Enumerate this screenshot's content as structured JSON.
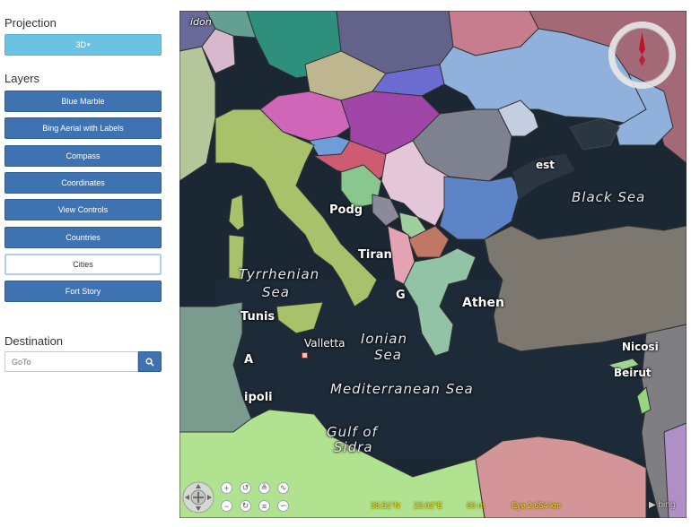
{
  "sidebar": {
    "projection_title": "Projection",
    "projection_value": "3D",
    "projection_caret": "▾",
    "layers_title": "Layers",
    "layers": [
      {
        "label": "Blue Marble",
        "active": false
      },
      {
        "label": "Bing Aerial with Labels",
        "active": false
      },
      {
        "label": "Compass",
        "active": false
      },
      {
        "label": "Coordinates",
        "active": false
      },
      {
        "label": "View Controls",
        "active": false
      },
      {
        "label": "Countries",
        "active": false
      },
      {
        "label": "Cities",
        "active": true
      },
      {
        "label": "Fort Story",
        "active": false
      }
    ],
    "destination_title": "Destination",
    "goto_placeholder": "GoTo"
  },
  "map": {
    "labels": {
      "don": "idon",
      "podg": "Podg",
      "tiran": "Tiran",
      "tyrr1": "Tyrrhenian",
      "tyrr2": "Sea",
      "tunis": "Tunis",
      "valletta": "Valletta",
      "ionian1": "Ionian",
      "ionian2": "Sea",
      "athen": "Athen",
      "g": "G",
      "a": "A",
      "ipoli": "ipoli",
      "med": "Mediterranean Sea",
      "gulf1": "Gulf of",
      "gulf2": "Sidra",
      "black": "Black Sea",
      "est": "est",
      "nicosi": "Nicosi",
      "beirut": "Beirut"
    },
    "status": {
      "lat": "38.51°N",
      "lon": "23.02°E",
      "alt": "60 m",
      "eye": "Eye  2,654 km",
      "logo": "bing"
    },
    "colors": {
      "sea": "#1b2733",
      "button": "#3f72b0",
      "projection_button": "#6bc3e3",
      "status_text": "#f2e000"
    }
  }
}
